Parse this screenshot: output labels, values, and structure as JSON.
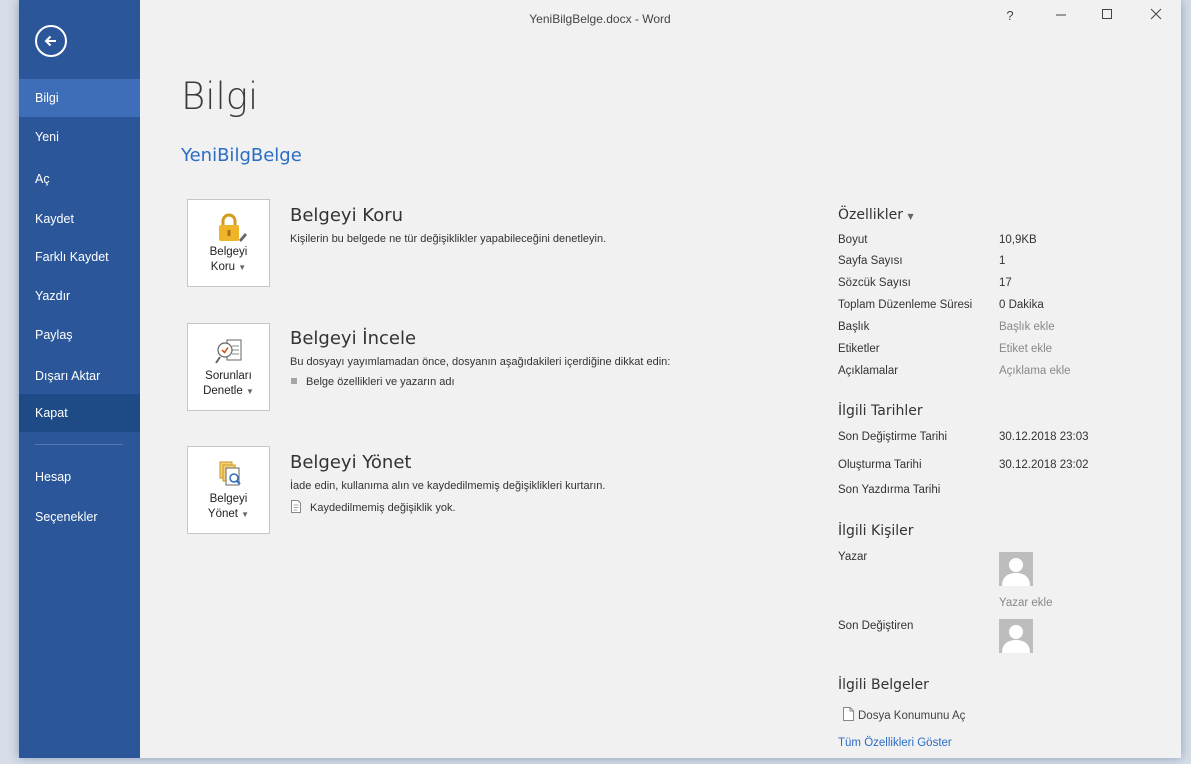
{
  "window": {
    "title": "YeniBilgBelge.docx - Word"
  },
  "sidebar": {
    "items": [
      {
        "label": "Bilgi"
      },
      {
        "label": "Yeni"
      },
      {
        "label": "Aç"
      },
      {
        "label": "Kaydet"
      },
      {
        "label": "Farklı Kaydet"
      },
      {
        "label": "Yazdır"
      },
      {
        "label": "Paylaş"
      },
      {
        "label": "Dışarı Aktar"
      },
      {
        "label": "Kapat"
      },
      {
        "label": "Hesap"
      },
      {
        "label": "Seçenekler"
      }
    ],
    "active": "Bilgi"
  },
  "main": {
    "title": "Bilgi",
    "doc_name": "YeniBilgBelge",
    "sections": {
      "protect": {
        "button": [
          "Belgeyi",
          "Koru"
        ],
        "title": "Belgeyi Koru",
        "desc": "Kişilerin bu belgede ne tür değişiklikler yapabileceğini denetleyin."
      },
      "inspect": {
        "button": [
          "Sorunları",
          "Denetle"
        ],
        "title": "Belgeyi İncele",
        "desc": "Bu dosyayı yayımlamadan önce, dosyanın aşağıdakileri içerdiğine dikkat edin:",
        "items": [
          "Belge özellikleri ve yazarın adı"
        ]
      },
      "manage": {
        "button": [
          "Belgeyi",
          "Yönet"
        ],
        "title": "Belgeyi Yönet",
        "desc": "İade edin, kullanıma alın ve kaydedilmemiş değişiklikleri kurtarın.",
        "items": [
          "Kaydedilmemiş değişiklik yok."
        ]
      }
    }
  },
  "properties": {
    "header": "Özellikler",
    "rows": [
      {
        "label": "Boyut",
        "value": "10,9KB"
      },
      {
        "label": "Sayfa Sayısı",
        "value": "1"
      },
      {
        "label": "Sözcük Sayısı",
        "value": "17"
      },
      {
        "label": "Toplam Düzenleme Süresi",
        "value": "0 Dakika"
      },
      {
        "label": "Başlık",
        "value": "Başlık ekle"
      },
      {
        "label": "Etiketler",
        "value": "Etiket ekle"
      },
      {
        "label": "Açıklamalar",
        "value": "Açıklama ekle"
      }
    ],
    "dates_header": "İlgili Tarihler",
    "dates": [
      {
        "label": "Son Değiştirme Tarihi",
        "value": "30.12.2018 23:03"
      },
      {
        "label": "Oluşturma Tarihi",
        "value": "30.12.2018 23:02"
      },
      {
        "label": "Son Yazdırma Tarihi",
        "value": ""
      }
    ],
    "people_header": "İlgili Kişiler",
    "author_label": "Yazar",
    "add_author": "Yazar ekle",
    "last_modified_by_label": "Son Değiştiren",
    "docs_header": "İlgili Belgeler",
    "open_location": "Dosya Konumunu Aç",
    "show_all": "Tüm Özellikleri Göster"
  },
  "colors": {
    "sidebar": "#2b579a",
    "sidebar_active": "#3f6eb9",
    "link": "#2b6cc4",
    "background": "#f1f1f1"
  }
}
